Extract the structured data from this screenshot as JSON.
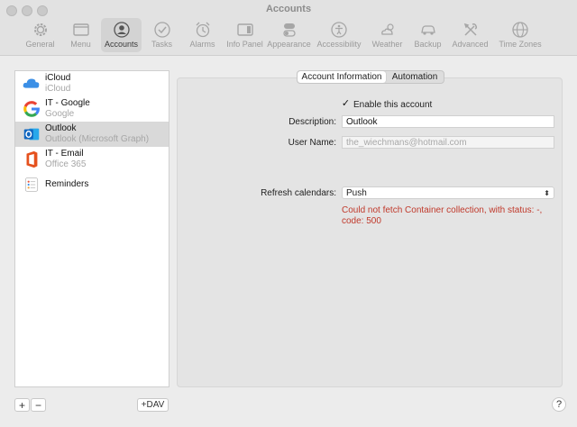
{
  "window": {
    "title": "Accounts"
  },
  "toolbar": {
    "items": [
      {
        "label": "General",
        "icon": "gear-icon"
      },
      {
        "label": "Menu",
        "icon": "menu-window-icon"
      },
      {
        "label": "Accounts",
        "icon": "person-circle-icon",
        "selected": true
      },
      {
        "label": "Tasks",
        "icon": "checkmark-circle-icon"
      },
      {
        "label": "Alarms",
        "icon": "alarm-clock-icon"
      },
      {
        "label": "Info Panel",
        "icon": "info-panel-icon"
      },
      {
        "label": "Appearance",
        "icon": "toggles-icon"
      },
      {
        "label": "Accessibility",
        "icon": "accessibility-icon"
      },
      {
        "label": "Weather",
        "icon": "weather-cloud-sun-icon"
      },
      {
        "label": "Backup",
        "icon": "car-backup-icon"
      },
      {
        "label": "Advanced",
        "icon": "tools-icon"
      },
      {
        "label": "Time Zones",
        "icon": "globe-icon"
      }
    ]
  },
  "sidebar": {
    "accounts": [
      {
        "name": "iCloud",
        "sub": "iCloud",
        "icon": "icloud-icon"
      },
      {
        "name": "IT - Google",
        "sub": "Google",
        "icon": "google-icon"
      },
      {
        "name": "Outlook",
        "sub": "Outlook (Microsoft Graph)",
        "icon": "outlook-icon",
        "selected": true
      },
      {
        "name": "IT - Email",
        "sub": "Office 365",
        "icon": "office365-icon"
      },
      {
        "name": "Reminders",
        "sub": "",
        "icon": "reminders-icon"
      }
    ],
    "add_label": "+",
    "remove_label": "−",
    "add_dav_label": "+DAV"
  },
  "tabs": {
    "account_info": "Account Information",
    "automation": "Automation"
  },
  "form": {
    "enable_checkbox_mark": "✓",
    "enable_label": "Enable this account",
    "description_label": "Description:",
    "description_value": "Outlook",
    "username_label": "User Name:",
    "username_value": "the_wiechmans@hotmail.com",
    "refresh_label": "Refresh calendars:",
    "refresh_value": "Push",
    "error_line1": "Could not fetch Container collection, with status: -,",
    "error_line2": "code: 500"
  },
  "help_label": "?",
  "colors": {
    "error": "#c0392b",
    "selected_row": "#d9d9d9",
    "icloud_blue": "#3b8fe6",
    "outlook_blue": "#1066c0",
    "office_orange": "#e5511e"
  }
}
